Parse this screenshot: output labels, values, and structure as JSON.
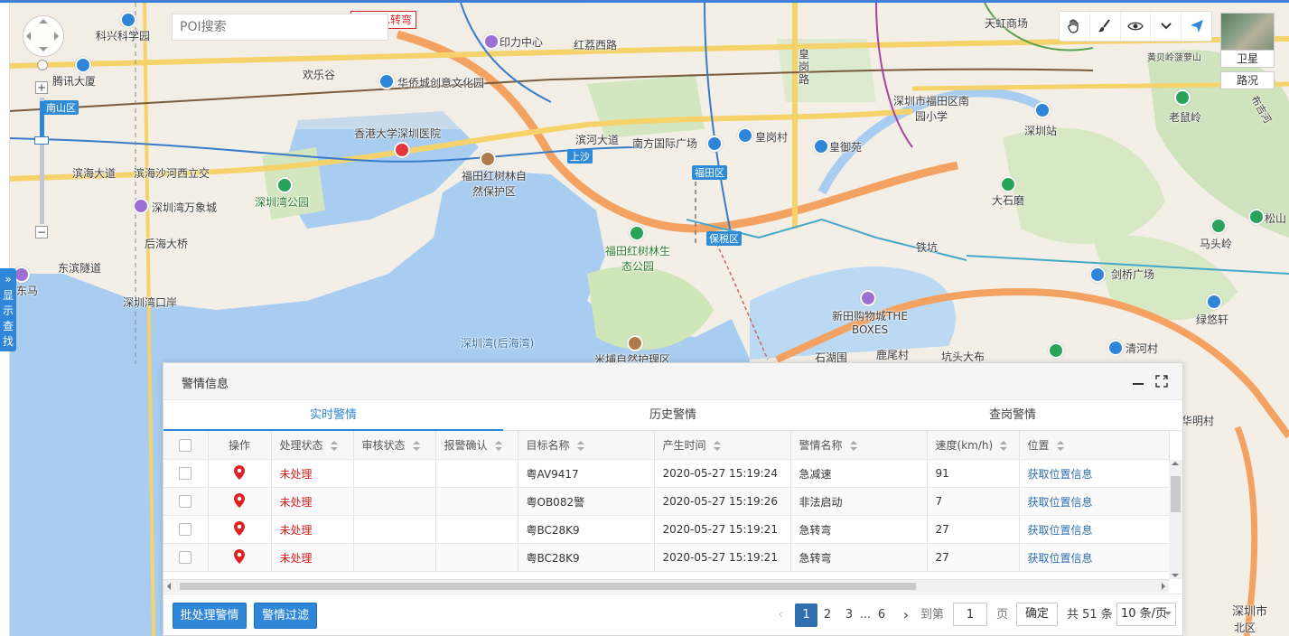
{
  "map": {
    "search_placeholder": "POI搜索",
    "alert_tag": "8K9 急转弯",
    "show_search_label": "显示查找",
    "satellite_label": "卫星",
    "traffic_label": "路况",
    "labels": [
      "科兴科学园",
      "腾讯大厦",
      "南山区",
      "滨海大道",
      "滨海沙河西立交",
      "深圳湾公园",
      "深圳湾万象城",
      "后海大桥",
      "东滨隧道",
      "东马",
      "深圳湾口岸",
      "深圳湾(后海湾)",
      "欢乐谷",
      "华侨城创意文化园",
      "印力中心",
      "香港大学深圳医院",
      "福田红树林自然保护区",
      "福田红树林生态公园",
      "米埔自然护理区",
      "红荔西路",
      "滨河大道",
      "南方国际广场",
      "皇岗村",
      "皇御苑",
      "福田区",
      "上沙",
      "保税区",
      "皇岗路",
      "天虹商场",
      "深圳市福田区南园小学",
      "深圳站",
      "老鼠岭",
      "大石磨",
      "松山",
      "马头岭",
      "剑桥广场",
      "新田购物城THE BOXES",
      "铁坑",
      "鹿尾村",
      "坑头大布",
      "石湖围",
      "清河村",
      "绿悠轩",
      "华明村",
      "黄贝岭菠萝山",
      "深圳市",
      "北区",
      "布吉河"
    ]
  },
  "panel": {
    "title": "警情信息",
    "tabs": [
      "实时警情",
      "历史警情",
      "查岗警情"
    ],
    "active_tab": 0,
    "columns": [
      "操作",
      "处理状态",
      "审核状态",
      "报警确认",
      "目标名称",
      "产生时间",
      "警情名称",
      "速度(km/h)",
      "位置"
    ],
    "rows": [
      {
        "status": "未处理",
        "review": "",
        "confirm": "",
        "target": "粤AV9417",
        "time": "2020-05-27 15:19:24",
        "alarm": "急减速",
        "speed": "91",
        "location": "获取位置信息"
      },
      {
        "status": "未处理",
        "review": "",
        "confirm": "",
        "target": "粤OB082警",
        "time": "2020-05-27 15:19:26",
        "alarm": "非法启动",
        "speed": "7",
        "location": "获取位置信息"
      },
      {
        "status": "未处理",
        "review": "",
        "confirm": "",
        "target": "粤BC28K9",
        "time": "2020-05-27 15:19:21",
        "alarm": "急转弯",
        "speed": "27",
        "location": "获取位置信息"
      },
      {
        "status": "未处理",
        "review": "",
        "confirm": "",
        "target": "粤BC28K9",
        "time": "2020-05-27 15:19:21",
        "alarm": "急转弯",
        "speed": "27",
        "location": "获取位置信息"
      }
    ],
    "buttons": {
      "batch": "批处理警情",
      "filter": "警情过滤"
    },
    "pagination": {
      "pages": [
        "1",
        "2",
        "3",
        "...",
        "6"
      ],
      "current": "1",
      "goto_label": "到第",
      "goto_value": "1",
      "page_unit": "页",
      "confirm": "确定",
      "total": "共 51 条",
      "page_size": "10 条/页"
    }
  },
  "colors": {
    "accent": "#2f86d8",
    "alert": "#d71d1d",
    "link": "#2f6fb0"
  }
}
